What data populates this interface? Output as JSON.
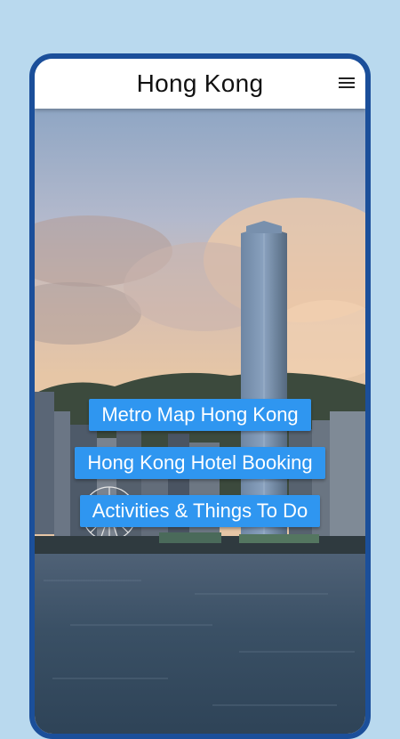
{
  "app": {
    "title": "Hong Kong",
    "menu_icon": "hamburger-menu-icon"
  },
  "links": [
    {
      "label": "Metro Map Hong Kong"
    },
    {
      "label": "Hong Kong Hotel Booking"
    },
    {
      "label": "Activities & Things To Do"
    }
  ],
  "colors": {
    "frame": "#1b4f9a",
    "button": "#2f96f0",
    "background": "#b9d9ee"
  }
}
